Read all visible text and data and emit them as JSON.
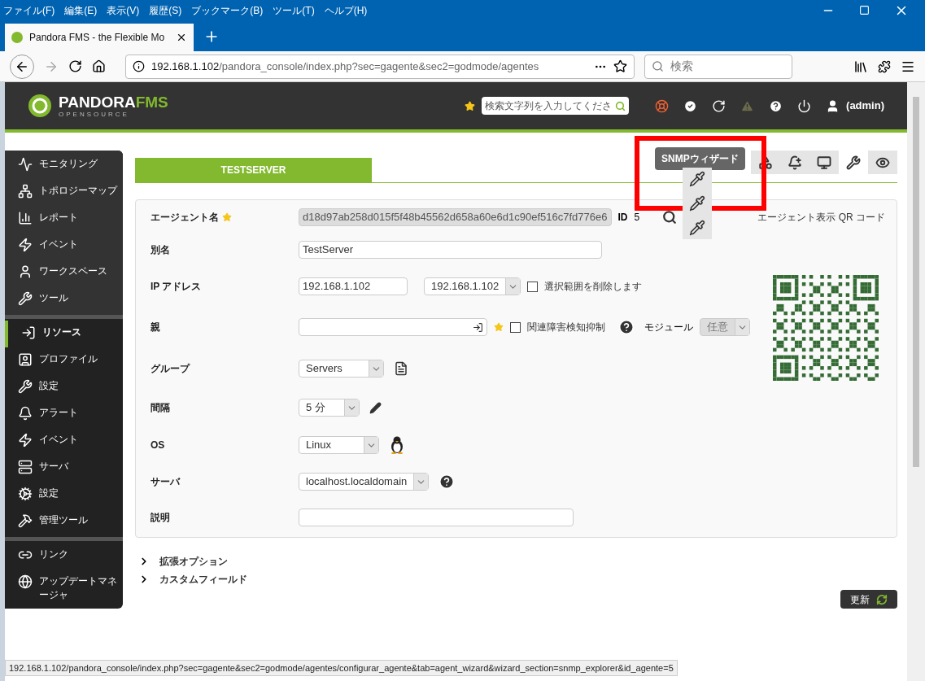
{
  "menu": [
    "ファイル(F)",
    "編集(E)",
    "表示(V)",
    "履歴(S)",
    "ブックマーク(B)",
    "ツール(T)",
    "ヘルプ(H)"
  ],
  "browser_tab": {
    "title": "Pandora FMS - the Flexible Mo"
  },
  "address_bar": {
    "host": "192.168.1.102",
    "path": "/pandora_console/index.php?sec=gagente&sec2=godmode/agentes"
  },
  "browser_search": {
    "placeholder": "検索"
  },
  "header": {
    "logo": "PANDORA",
    "logo_accent": "FMS",
    "logo_sub": "OPENSOURCE",
    "search_placeholder": "検索文字列を入力してくださ",
    "user": "(admin)"
  },
  "sidebar": {
    "groups": [
      [
        {
          "label": "モニタリング",
          "selected": false
        },
        {
          "label": "トポロジーマップ",
          "selected": false
        },
        {
          "label": "レポート",
          "selected": false
        },
        {
          "label": "イベント",
          "selected": false
        },
        {
          "label": "ワークスペース",
          "selected": false
        },
        {
          "label": "ツール",
          "selected": false
        }
      ],
      [
        {
          "label": "リソース",
          "selected": true
        },
        {
          "label": "プロファイル",
          "selected": false
        },
        {
          "label": "設定",
          "selected": false
        },
        {
          "label": "アラート",
          "selected": false
        },
        {
          "label": "イベント",
          "selected": false
        },
        {
          "label": "サーバ",
          "selected": false
        },
        {
          "label": "設定",
          "selected": false
        },
        {
          "label": "管理ツール",
          "selected": false
        }
      ],
      [
        {
          "label": "リンク",
          "selected": false
        },
        {
          "label": "アップデートマネージャ",
          "selected": false
        }
      ]
    ]
  },
  "agent_tab": {
    "title": "TESTSERVER"
  },
  "toolbar": {
    "tooltip": "SNMPウィザード",
    "buttons": [
      {
        "selected": false
      },
      {
        "selected": false
      },
      {
        "selected": false
      },
      {
        "selected": true
      },
      {
        "selected": false
      }
    ]
  },
  "form": {
    "qr_title": "エージェント表示 QR コード",
    "rows": [
      {
        "kind": "agent_name",
        "label": "エージェント名",
        "value": "d18d97ab258d015f5f48b45562d658a60e6d1c90ef516c7fd776e6",
        "id_label": "ID",
        "id": "5"
      },
      {
        "kind": "text",
        "label": "別名",
        "value": "TestServer"
      },
      {
        "kind": "ip",
        "label": "IP アドレス",
        "value": "192.168.1.102",
        "select": "192.168.1.102",
        "checkbox": {
          "label": "選択範囲を削除します",
          "checked": false
        }
      },
      {
        "kind": "parent",
        "label": "親",
        "checkbox": {
          "label": "関連障害検知抑制",
          "checked": false
        },
        "module_label": "モジュール",
        "module_select": "任意",
        "module_disabled": true
      },
      {
        "kind": "group",
        "label": "グループ",
        "value": "Servers"
      },
      {
        "kind": "interval",
        "label": "間隔",
        "value": "5 分"
      },
      {
        "kind": "os",
        "label": "OS",
        "value": "Linux"
      },
      {
        "kind": "server",
        "label": "サーバ",
        "value": "localhost.localdomain"
      },
      {
        "kind": "description",
        "label": "説明"
      }
    ]
  },
  "expanders": [
    {
      "label": "拡張オプション",
      "expanded": false
    },
    {
      "label": "カスタムフィールド",
      "expanded": false
    }
  ],
  "update_button": "更新",
  "status_url": "192.168.1.102/pandora_console/index.php?sec=gagente&sec2=godmode/agentes/configurar_agente&tab=agent_wizard&wizard_section=snmp_explorer&id_agente=5"
}
